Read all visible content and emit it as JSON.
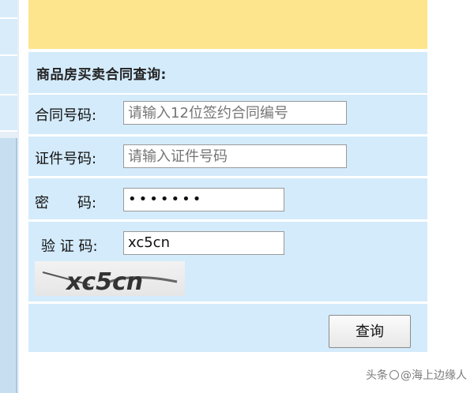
{
  "panel": {
    "title": "商品房买卖合同查询:"
  },
  "form": {
    "contract": {
      "label": "合同号码:",
      "value": "",
      "placeholder": "请输入12位签约合同编号"
    },
    "id": {
      "label": "证件号码:",
      "value": "",
      "placeholder": "请输入证件号码"
    },
    "password": {
      "label": "密　　码:",
      "value": "•••••••"
    },
    "captcha": {
      "label": "验 证 码:",
      "value": "xc5cn",
      "image_text": "xc5cn"
    }
  },
  "buttons": {
    "query_label": "查询"
  },
  "watermark": {
    "prefix": "头条",
    "handle": "@海上边缘人"
  }
}
